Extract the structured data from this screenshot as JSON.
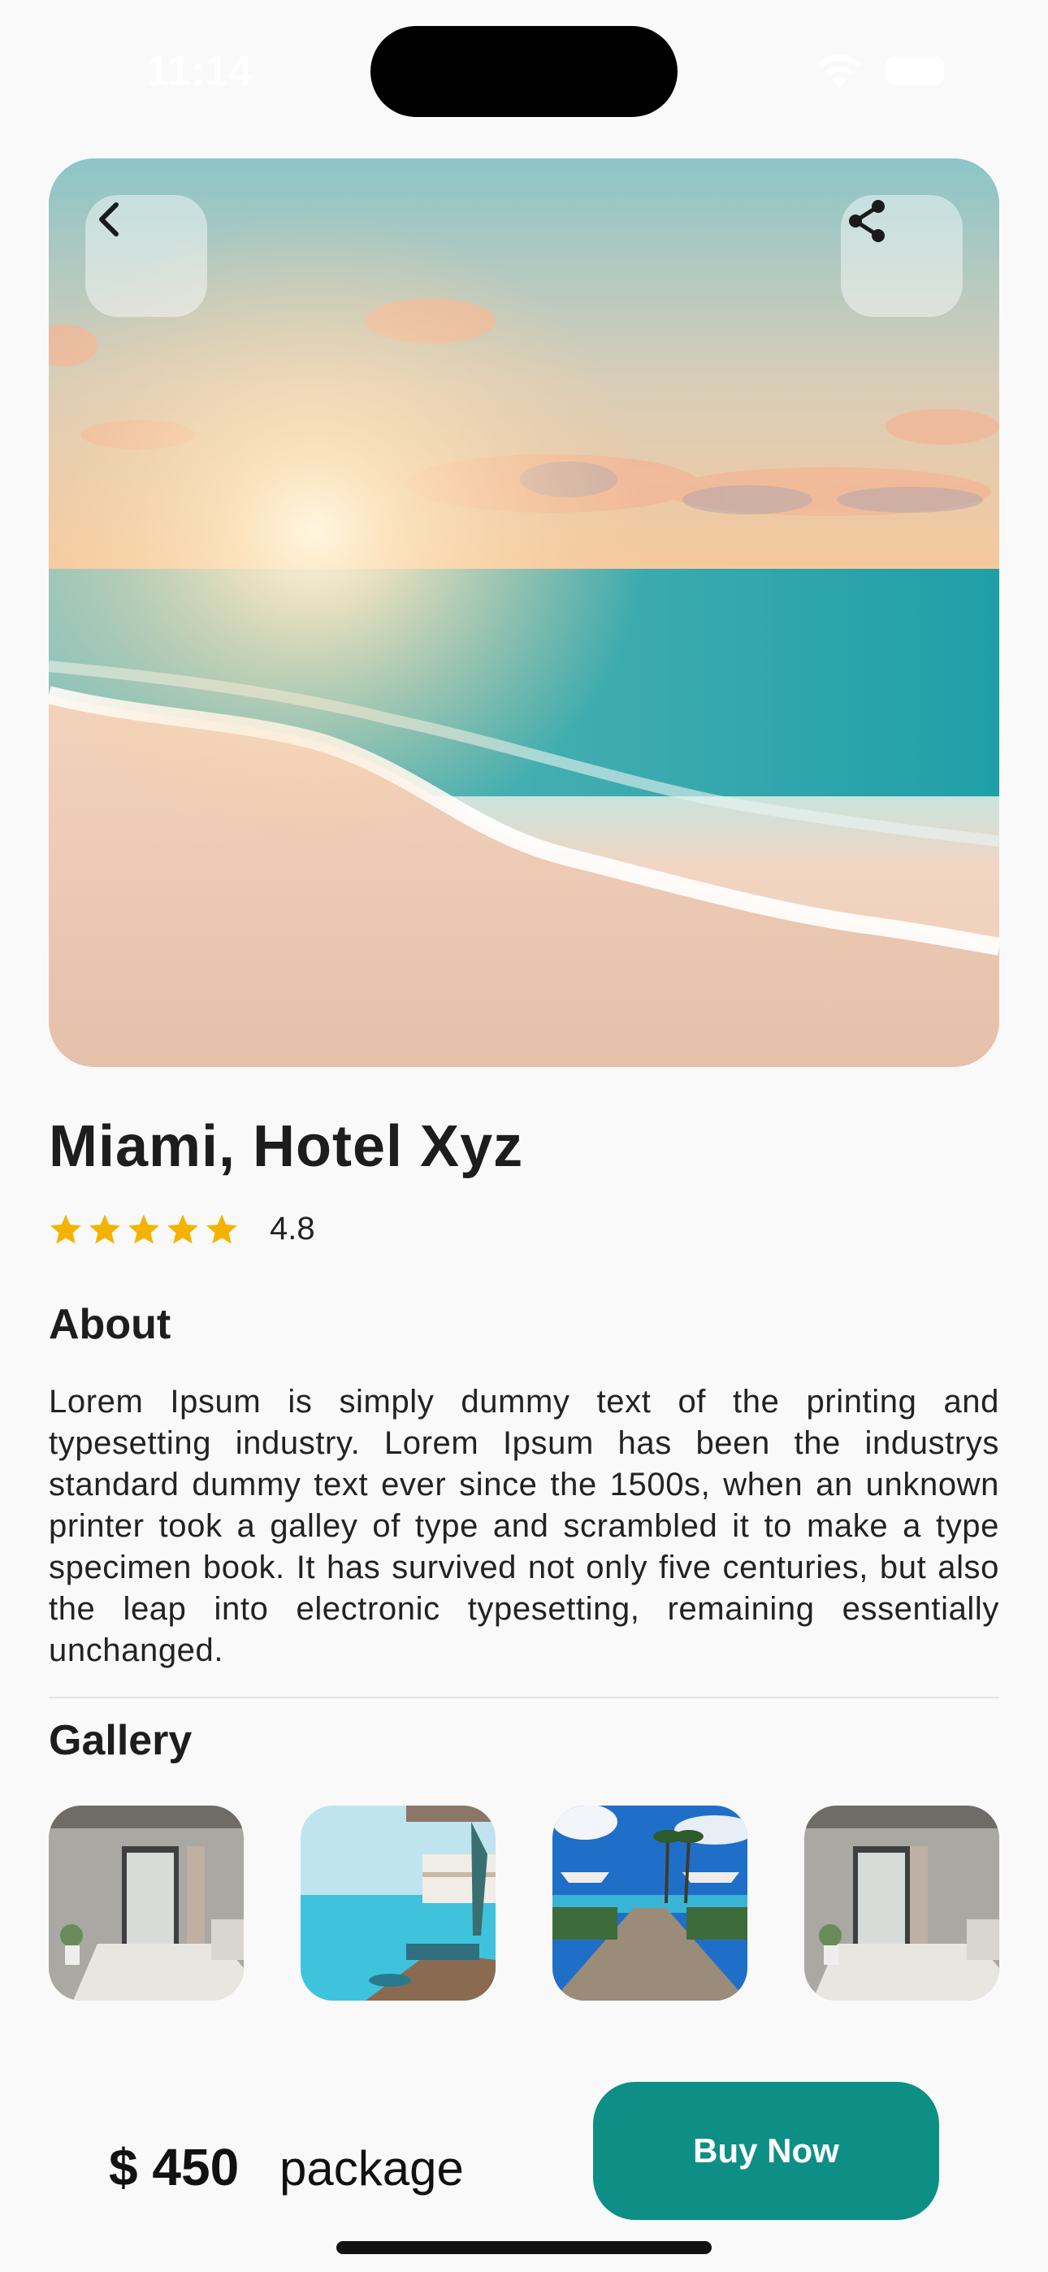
{
  "status_bar": {
    "time": "11:14"
  },
  "hero": {
    "image_description_icon": "beach-sunset-image",
    "back_icon": "chevron-left-icon",
    "share_icon": "share-icon"
  },
  "hotel": {
    "title": "Miami, Hotel Xyz",
    "rating": "4.8",
    "stars": 5,
    "star_color": "#f5b301"
  },
  "about": {
    "heading": "About",
    "text": "Lorem Ipsum is simply dummy text of the printing and typesetting industry. Lorem Ipsum has been the industrys standard dummy text ever since the 1500s, when an unknown printer took a galley of type and scrambled it to make a type specimen book. It has survived not only five centuries, but also the leap into electronic typesetting, remaining essentially unchanged."
  },
  "gallery": {
    "heading": "Gallery",
    "thumbnails": [
      "bedroom-image",
      "pool-image",
      "beach-walkway-image",
      "bedroom-image"
    ]
  },
  "footer": {
    "price": "$ 450",
    "price_suffix": "package",
    "buy_label": "Buy Now",
    "accent_color": "#0e8f86"
  }
}
